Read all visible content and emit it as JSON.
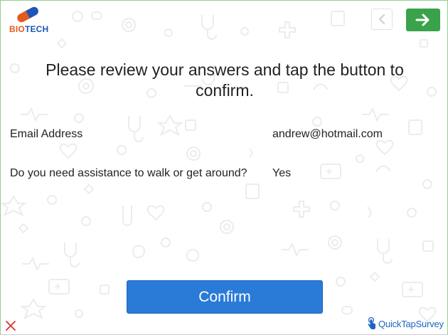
{
  "header": {
    "logo_text_bio": "BIO",
    "logo_text_tech": "TECH",
    "back_icon": "chevron-left-icon",
    "next_icon": "arrow-right-icon"
  },
  "main": {
    "title": "Please review your answers and tap the button to confirm.",
    "answers": [
      {
        "label": "Email Address",
        "value": "andrew@hotmail.com"
      },
      {
        "label": "Do you need assistance to walk or get around?",
        "value": "Yes"
      }
    ],
    "confirm_label": "Confirm"
  },
  "footer": {
    "close_icon": "close-icon",
    "brand_text": "QuickTapSurvey",
    "brand_icon": "tap-hand-icon"
  },
  "colors": {
    "accent_green": "#3aa24a",
    "confirm_blue": "#2a7ad8",
    "brand_blue": "#1d64c4",
    "close_red": "#d9322b",
    "logo_orange": "#e25a1c",
    "logo_blue": "#1d56b8"
  }
}
